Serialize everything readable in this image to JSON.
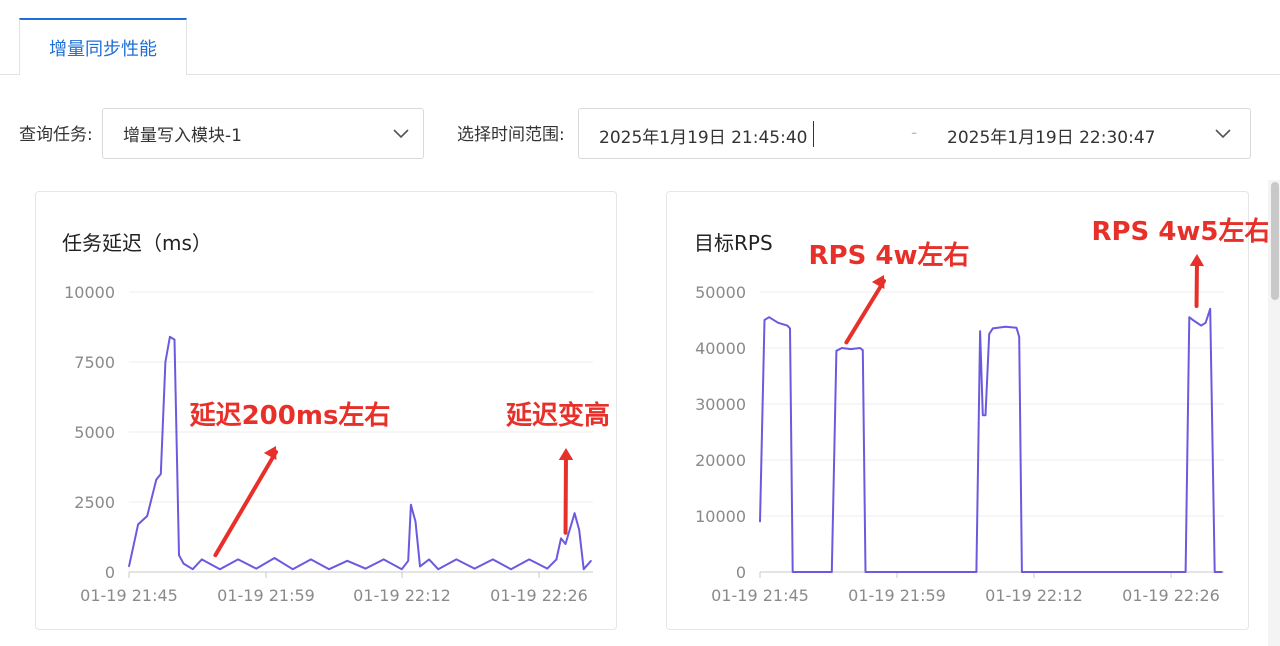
{
  "tabs": [
    {
      "label": "增量同步性能",
      "active": true
    }
  ],
  "filters": {
    "task_label": "查询任务:",
    "task_value": "增量写入模块-1",
    "time_label": "选择时间范围:",
    "time_start": "2025年1月19日 21:45:40",
    "time_separator": "-",
    "time_end": "2025年1月19日 22:30:47"
  },
  "colors": {
    "accent": "#1f6fd6",
    "series": "#6a5ae0",
    "annotation": "#e8302a"
  },
  "cards": [
    {
      "title": "任务延迟（ms）"
    },
    {
      "title": "目标RPS"
    }
  ],
  "chart_data": [
    {
      "type": "line",
      "title": "任务延迟（ms）",
      "xlabel": "",
      "ylabel": "",
      "x_tick_labels": [
        "01-19 21:45",
        "01-19 21:59",
        "01-19 22:12",
        "01-19 22:26"
      ],
      "y_tick_labels": [
        "0",
        "2500",
        "5000",
        "7500",
        "10000"
      ],
      "ylim": [
        0,
        10000
      ],
      "x_minutes": [
        0,
        1,
        2,
        3,
        3.5,
        4,
        4.5,
        5,
        5.5,
        6,
        7,
        8,
        10,
        12,
        14,
        16,
        18,
        20,
        22,
        24,
        26,
        28,
        30,
        30.7,
        31,
        31.5,
        32,
        33,
        34,
        36,
        38,
        40,
        42,
        44,
        46,
        47,
        47.5,
        48,
        49,
        49.5,
        50,
        50.8
      ],
      "series": [
        {
          "values": [
            200,
            1700,
            2000,
            3300,
            3500,
            7500,
            8400,
            8300,
            600,
            300,
            100,
            450,
            100,
            450,
            120,
            500,
            100,
            450,
            100,
            400,
            120,
            450,
            100,
            400,
            2400,
            1800,
            200,
            450,
            100,
            450,
            120,
            450,
            100,
            450,
            120,
            450,
            1200,
            1000,
            2100,
            1500,
            100,
            400
          ]
        }
      ],
      "grid": true,
      "annotations": [
        {
          "text": "延迟200ms左右",
          "arrow_to_minute": 9.5,
          "arrow_to_value": 600
        },
        {
          "text": "延迟变高",
          "arrow_to_minute": 48,
          "arrow_to_value": 1400
        }
      ]
    },
    {
      "type": "line",
      "title": "目标RPS",
      "xlabel": "",
      "ylabel": "",
      "x_tick_labels": [
        "01-19 21:45",
        "01-19 21:59",
        "01-19 22:12",
        "01-19 22:26"
      ],
      "y_tick_labels": [
        "0",
        "10000",
        "20000",
        "30000",
        "40000",
        "50000"
      ],
      "ylim": [
        0,
        50000
      ],
      "x_minutes": [
        0,
        0.5,
        1,
        2,
        3,
        3.3,
        3.6,
        7.9,
        8.4,
        9,
        10,
        11,
        11.3,
        11.6,
        23.8,
        24.2,
        24.5,
        24.8,
        25.2,
        25.6,
        27,
        28.2,
        28.5,
        28.8,
        46.8,
        47.2,
        47.6,
        48.5,
        49,
        49.5,
        50,
        50.8
      ],
      "series": [
        {
          "values": [
            9000,
            45000,
            45500,
            44500,
            44000,
            43500,
            0,
            0,
            39500,
            40000,
            39800,
            40000,
            39600,
            0,
            0,
            43000,
            28000,
            28000,
            42500,
            43500,
            43800,
            43600,
            42000,
            0,
            0,
            45500,
            45000,
            44000,
            44500,
            47000,
            0,
            0
          ]
        }
      ],
      "grid": true,
      "annotations": [
        {
          "text": "RPS 4w左右",
          "arrow_to_minute": 9.5,
          "arrow_to_value": 41000
        },
        {
          "text": "RPS 4w5左右",
          "arrow_to_minute": 48,
          "arrow_to_value": 47500
        }
      ]
    }
  ]
}
